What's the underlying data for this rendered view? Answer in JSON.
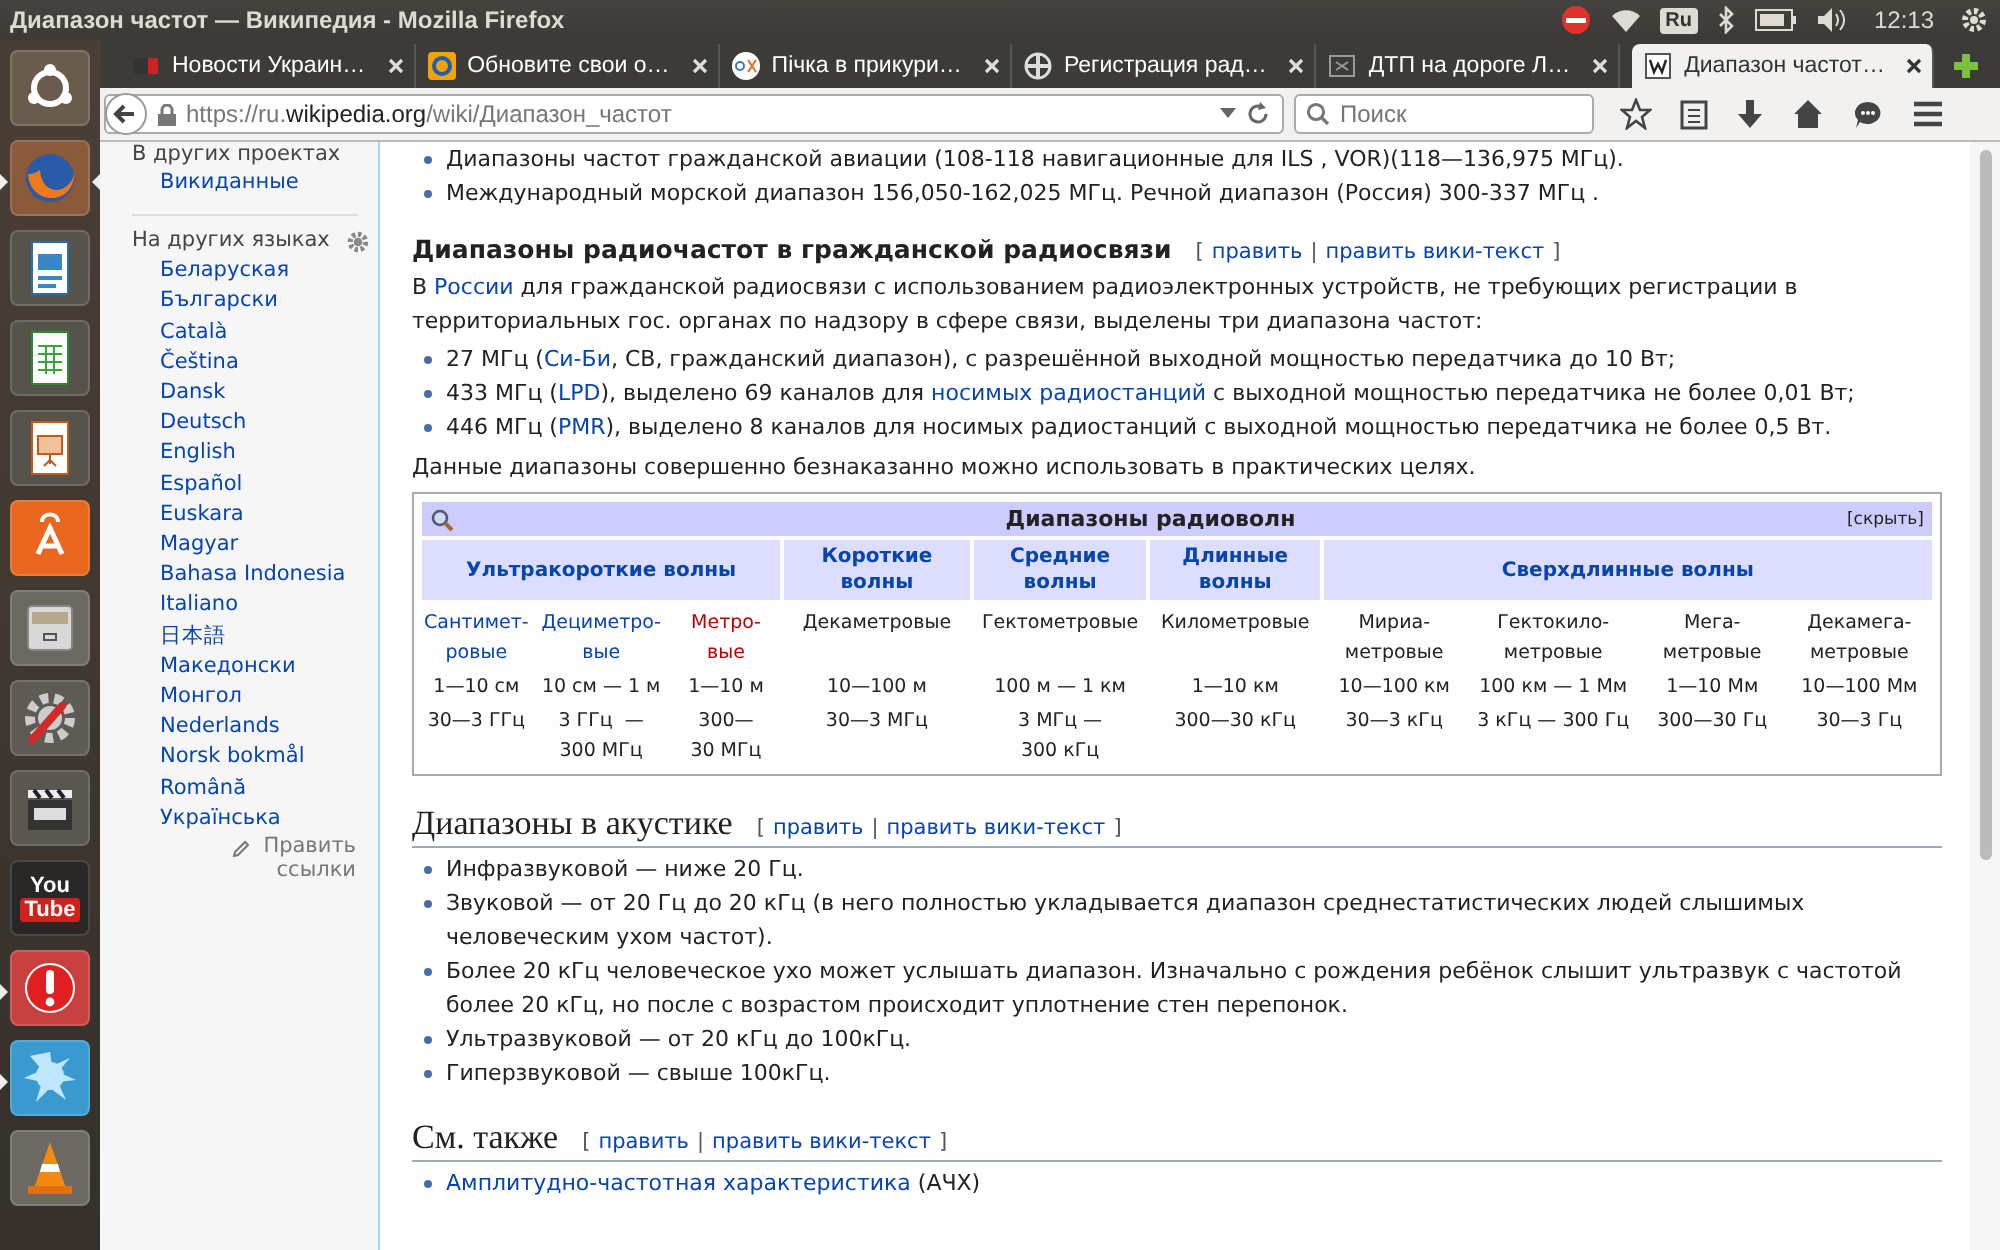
{
  "panel": {
    "title": "Диапазон частот — Википедия - Mozilla Firefox",
    "keyboard": "Ru",
    "time": "12:13"
  },
  "launcher": [
    {
      "kind": "ubuntu",
      "running": false,
      "focused": false
    },
    {
      "kind": "firefox",
      "running": true,
      "focused": true
    },
    {
      "kind": "writer",
      "running": false,
      "focused": false
    },
    {
      "kind": "calc",
      "running": false,
      "focused": false
    },
    {
      "kind": "impress",
      "running": false,
      "focused": false
    },
    {
      "kind": "store",
      "running": false,
      "focused": false
    },
    {
      "kind": "files",
      "running": false,
      "focused": false
    },
    {
      "kind": "settings",
      "running": false,
      "focused": false
    },
    {
      "kind": "video",
      "running": false,
      "focused": false
    },
    {
      "kind": "youtube",
      "running": false,
      "focused": false,
      "label_top": "You",
      "label_bottom": "Tube"
    },
    {
      "kind": "alert",
      "running": true,
      "focused": false
    },
    {
      "kind": "splash",
      "running": true,
      "focused": false
    },
    {
      "kind": "vlc",
      "running": false,
      "focused": false
    }
  ],
  "tabs": [
    {
      "label": "Новости Украин…",
      "kind": "news",
      "selected": false
    },
    {
      "label": "Обновите свои о…",
      "kind": "mail",
      "selected": false
    },
    {
      "label": "Пічка в прикури…",
      "kind": "olx",
      "selected": false
    },
    {
      "label": "Регистрация рад…",
      "kind": "cross",
      "selected": false
    },
    {
      "label": "ДТП на дороге Л…",
      "kind": "ex",
      "selected": false
    },
    {
      "label": "Диапазон частот…",
      "kind": "wiki",
      "selected": true
    }
  ],
  "address": {
    "prefix": "https://ru.",
    "domain": "wikipedia.org",
    "path": "/wiki/Диапазон_частот"
  },
  "search": {
    "placeholder": "Поиск"
  },
  "sidebar": {
    "projects_heading": "В других проектах",
    "projects": [
      "Викиданные"
    ],
    "languages_heading": "На других языках",
    "languages": [
      "Беларуская",
      "Български",
      "Català",
      "Čeština",
      "Dansk",
      "Deutsch",
      "English",
      "Español",
      "Euskara",
      "Magyar",
      "Bahasa Indonesia",
      "Italiano",
      "日本語",
      "Македонски",
      "Монгол",
      "Nederlands",
      "Norsk bokmål",
      "Română",
      "Українська"
    ],
    "edit_links": "Править ссылки"
  },
  "top_list": [
    [
      {
        "text": "Диапазоны частот гражданской авиации (108-118 навигационные для ILS , VOR)(118—136,975 МГц)."
      }
    ],
    [
      {
        "text": "Международный морской диапазон 156,050-162,025 МГц. Речной диапазон (Россия) 300-337 МГц ."
      }
    ]
  ],
  "section_radio": {
    "heading": "Диапазоны радиочастот в гражданской радиосвязи",
    "edit": {
      "open": "[",
      "links": [
        "править",
        "править вики-текст"
      ],
      "sep": "|",
      "close": "]"
    },
    "intro": [
      {
        "text": "В "
      },
      {
        "text": "России",
        "link": true
      },
      {
        "text": " для гражданской радиосвязи с использованием радиоэлектронных устройств, не требующих регистрации в территориальных гос. органах по надзору в сфере связи, выделены три диапазона частот:"
      }
    ],
    "items": [
      [
        {
          "text": "27 МГц ("
        },
        {
          "text": "Си-Би",
          "link": true
        },
        {
          "text": ", СВ, гражданский диапазон), с разрешённой выходной мощностью передатчика до 10 Вт;"
        }
      ],
      [
        {
          "text": "433 МГц ("
        },
        {
          "text": "LPD",
          "link": true
        },
        {
          "text": "), выделено 69 каналов для "
        },
        {
          "text": "носимых радиостанций",
          "link": true
        },
        {
          "text": " с выходной мощностью передатчика не более 0,01 Вт;"
        }
      ],
      [
        {
          "text": "446 МГц ("
        },
        {
          "text": "PMR",
          "link": true
        },
        {
          "text": "), выделено 8 каналов для носимых радиостанций с выходной мощностью передатчика не более 0,5 Вт."
        }
      ]
    ],
    "outro": [
      {
        "text": "Данные диапазоны совершенно безнаказанно можно использовать в практических целях."
      }
    ]
  },
  "table": {
    "title": "Диапазоны радиоволн",
    "toggle": "[скрыть]",
    "groups": [
      {
        "label": "Ультракороткие волны"
      },
      {
        "label": "Короткие\nволны"
      },
      {
        "label": "Средние\nволны"
      },
      {
        "label": "Длинные\nволны"
      },
      {
        "label": "Сверхдлинные волны"
      }
    ],
    "columns": [
      {
        "name": "Сантимет-\nровые",
        "kind": "link",
        "wavelength": "1—10 см",
        "frequency": "30—3 ГГц"
      },
      {
        "name": "Дециметро-\nвые",
        "kind": "link",
        "wavelength": "10 см — 1 м",
        "frequency": "3 ГГц  —\n300 МГц"
      },
      {
        "name": "Метро-\nвые",
        "kind": "redlink",
        "wavelength": "1—10 м",
        "frequency": "300—\n30 МГц"
      },
      {
        "name": "Декаметровые",
        "kind": "plain",
        "wavelength": "10—100 м",
        "frequency": "30—3 МГц"
      },
      {
        "name": "Гектометровые",
        "kind": "plain",
        "wavelength": "100 м — 1 км",
        "frequency": "3 МГц —\n300 кГц"
      },
      {
        "name": "Километровые",
        "kind": "plain",
        "wavelength": "1—10 км",
        "frequency": "300—30 кГц"
      },
      {
        "name": "Мириа-\nметровые",
        "kind": "plain",
        "wavelength": "10—100 км",
        "frequency": "30—3 кГц"
      },
      {
        "name": "Гектокило-\nметровые",
        "kind": "plain",
        "wavelength": "100 км — 1 Мм",
        "frequency": "3 кГц — 300 Гц"
      },
      {
        "name": "Мега-\nметровые",
        "kind": "plain",
        "wavelength": "1—10 Мм",
        "frequency": "300—30 Гц"
      },
      {
        "name": "Декамега-\nметровые",
        "kind": "plain",
        "wavelength": "10—100 Мм",
        "frequency": "30—3 Гц"
      }
    ]
  },
  "section_acoustic": {
    "heading": "Диапазоны в акустике",
    "edit": {
      "open": "[",
      "links": [
        "править",
        "править вики-текст"
      ],
      "sep": "|",
      "close": "]"
    },
    "items": [
      [
        {
          "text": "Инфразвуковой — ниже 20 Гц."
        }
      ],
      [
        {
          "text": "Звуковой — от 20 Гц до 20 кГц (в него полностью укладывается диапазон среднестатистических людей слышимых человеческим ухом частот)."
        }
      ],
      [
        {
          "text": "Более 20 кГц человеческое ухо может услышать диапазон. Изначально с рождения ребёнок слышит ультразвук с частотой более 20 кГц, но после с возрастом происходит уплотнение стен перепонок."
        }
      ],
      [
        {
          "text": "Ультразвуковой — от 20 кГц до 100кГц."
        }
      ],
      [
        {
          "text": "Гиперзвуковой — свыше 100кГц."
        }
      ]
    ]
  },
  "section_see": {
    "heading": "См. также",
    "edit": {
      "open": "[",
      "links": [
        "править",
        "править вики-текст"
      ],
      "sep": "|",
      "close": "]"
    },
    "items": [
      [
        {
          "text": "Амплитудно-частотная характеристика",
          "link": true
        },
        {
          "text": " (АЧХ)"
        }
      ]
    ]
  }
}
